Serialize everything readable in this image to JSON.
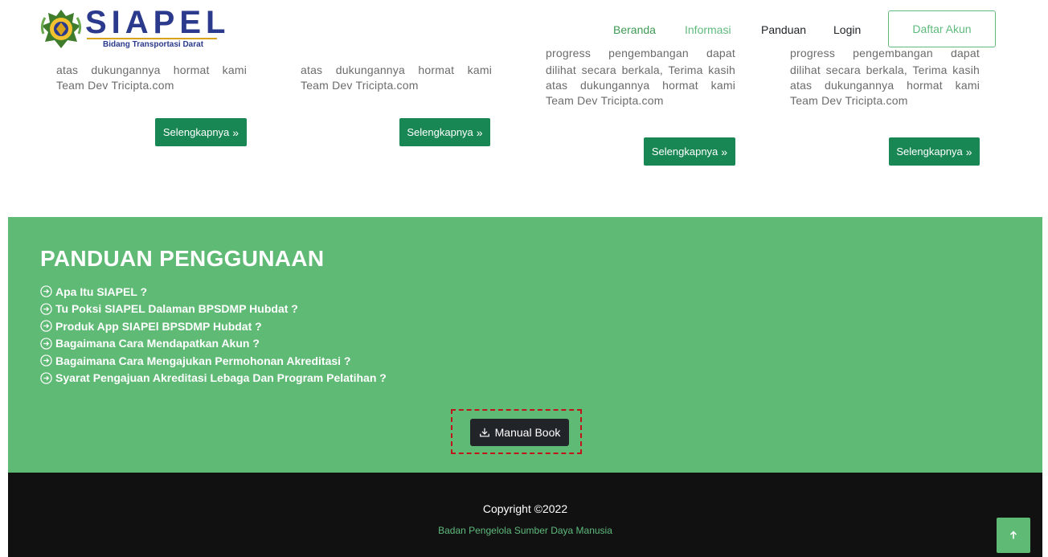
{
  "header": {
    "logo_text": "SIAPEL",
    "logo_subtitle": "Bidang Transportasi Darat",
    "nav": {
      "beranda": "Beranda",
      "informasi": "Informasi",
      "panduan": "Panduan",
      "login": "Login"
    },
    "daftar_label": "Daftar Akun"
  },
  "cards": [
    {
      "lines": [
        "atas dukungannya hormat kami",
        "Team Dev Tricipta.com"
      ],
      "button": "Selengkapnya"
    },
    {
      "lines": [
        "atas dukungannya hormat kami",
        "Team Dev Tricipta.com"
      ],
      "button": "Selengkapnya"
    },
    {
      "lines": [
        "progress pengembangan dapat",
        "dilihat secara berkala, Terima kasih",
        "atas dukungannya hormat kami",
        "Team Dev Tricipta.com"
      ],
      "button": "Selengkapnya"
    },
    {
      "lines": [
        "progress pengembangan dapat",
        "dilihat secara berkala, Terima kasih",
        "atas dukungannya hormat kami",
        "Team Dev Tricipta.com"
      ],
      "button": "Selengkapnya"
    }
  ],
  "panduan": {
    "title": "PANDUAN PENGGUNAAN",
    "items": [
      "Apa Itu SIAPEL ?",
      "Tu Poksi SIAPEL Dalaman BPSDMP Hubdat ?",
      "Produk App SIAPEl BPSDMP Hubdat ?",
      "Bagaimana Cara Mendapatkan Akun ?",
      "Bagaimana Cara Mengajukan Permohonan Akreditasi ?",
      "Syarat Pengajuan Akreditasi Lebaga Dan Program Pelatihan ?"
    ],
    "manual_label": "Manual Book"
  },
  "footer": {
    "copyright": "Copyright ©2022",
    "org": "Badan Pengelola Sumber Daya Manusia"
  },
  "colors": {
    "green_section": "#5fba75",
    "green_button": "#198754",
    "dark": "#111111",
    "brand_blue": "#2b3a8c",
    "highlight_red": "#c0161b"
  },
  "icons": {
    "faq": "circle-arrow-right-icon",
    "manual": "download-icon",
    "scroll_top": "arrow-up-icon",
    "selengkapnya": "double-chevron-right-icon"
  }
}
